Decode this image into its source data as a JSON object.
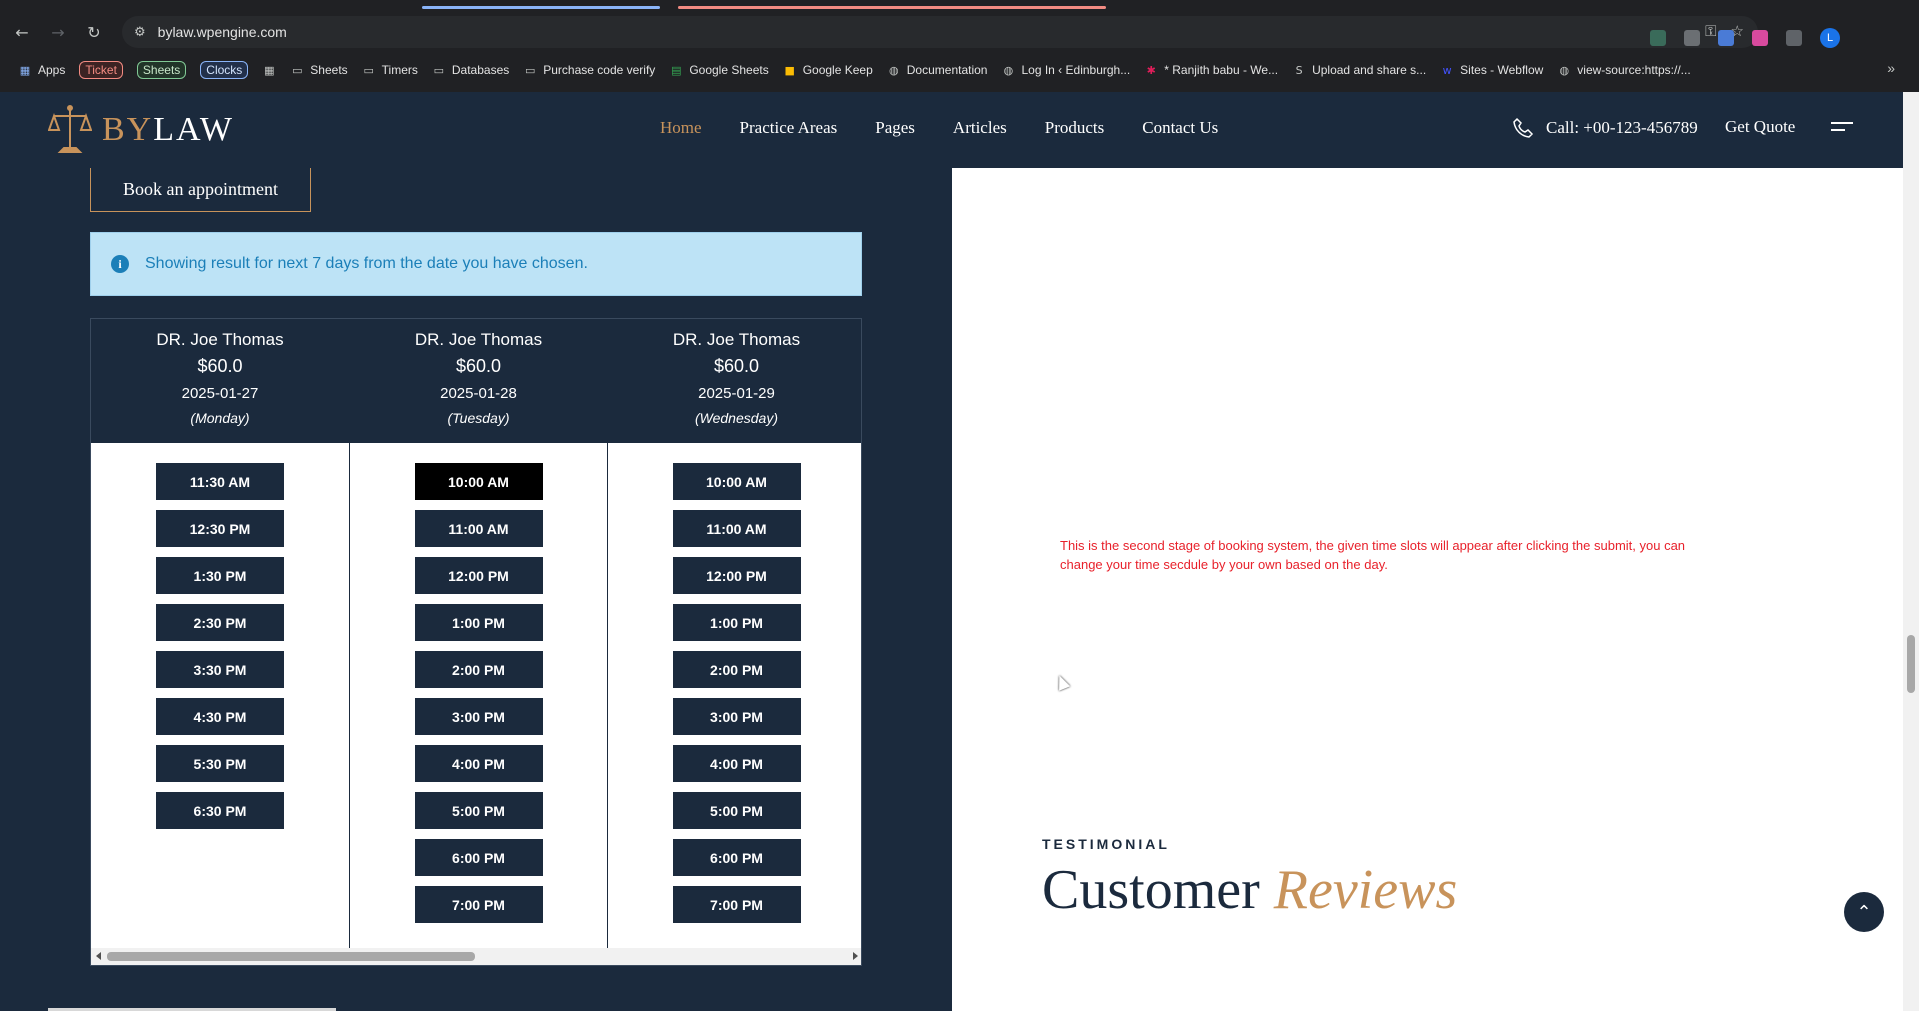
{
  "browser": {
    "url": "bylaw.wpengine.com",
    "bookmarks": [
      {
        "label": "Apps",
        "type": "apps"
      },
      {
        "label": "Ticket",
        "type": "chip-red"
      },
      {
        "label": "Sheets",
        "type": "chip-green"
      },
      {
        "label": "Clocks",
        "type": "chip-blue"
      },
      {
        "label": "",
        "type": "grid"
      },
      {
        "label": "Sheets",
        "type": "folder"
      },
      {
        "label": "Timers",
        "type": "folder"
      },
      {
        "label": "Databases",
        "type": "folder"
      },
      {
        "label": "Purchase code verify",
        "type": "folder"
      },
      {
        "label": "Google Sheets",
        "type": "gsheets"
      },
      {
        "label": "Google Keep",
        "type": "gkeep"
      },
      {
        "label": "Documentation",
        "type": "globe"
      },
      {
        "label": "Log In ‹ Edinburgh...",
        "type": "globe"
      },
      {
        "label": "* Ranjith babu - We...",
        "type": "slack"
      },
      {
        "label": "Upload and share s...",
        "type": "sb"
      },
      {
        "label": "Sites - Webflow",
        "type": "webflow"
      },
      {
        "label": "view-source:https://...",
        "type": "globe"
      }
    ]
  },
  "header": {
    "logo_by": "BY",
    "logo_law": "LAW",
    "menu": [
      "Home",
      "Practice Areas",
      "Pages",
      "Articles",
      "Products",
      "Contact Us"
    ],
    "call_label": "Call: +00-123-456789",
    "quote_label": "Get Quote"
  },
  "booking": {
    "book_button": "Book an appointment",
    "info_text": "Showing result for next 7 days from the date you have chosen.",
    "columns": [
      {
        "doctor": "DR. Joe Thomas",
        "price": "$60.0",
        "date": "2025-01-27",
        "day": "(Monday)",
        "slots": [
          "11:30 AM",
          "12:30 PM",
          "1:30 PM",
          "2:30 PM",
          "3:30 PM",
          "4:30 PM",
          "5:30 PM",
          "6:30 PM"
        ]
      },
      {
        "doctor": "DR. Joe Thomas",
        "price": "$60.0",
        "date": "2025-01-28",
        "day": "(Tuesday)",
        "slots": [
          "10:00 AM",
          "11:00 AM",
          "12:00 PM",
          "1:00 PM",
          "2:00 PM",
          "3:00 PM",
          "4:00 PM",
          "5:00 PM",
          "6:00 PM",
          "7:00 PM"
        ],
        "selected": "10:00 AM"
      },
      {
        "doctor": "DR. Joe Thomas",
        "price": "$60.0",
        "date": "2025-01-29",
        "day": "(Wednesday)",
        "slots": [
          "10:00 AM",
          "11:00 AM",
          "12:00 PM",
          "1:00 PM",
          "2:00 PM",
          "3:00 PM",
          "4:00 PM",
          "5:00 PM",
          "6:00 PM",
          "7:00 PM"
        ]
      }
    ]
  },
  "right": {
    "note": "This is the second stage of booking system, the given time slots will appear after clicking the submit, you can change your time secdule by your own based on the day.",
    "testimonial_label": "TESTIMONIAL",
    "reviews_word1": "Customer",
    "reviews_word2": "Reviews"
  },
  "colors": {
    "navy": "#1b2a3d",
    "gold": "#c8935b",
    "info_bg": "#bde3f6",
    "info_text": "#1b7fb8",
    "note_red": "#e8212b"
  }
}
